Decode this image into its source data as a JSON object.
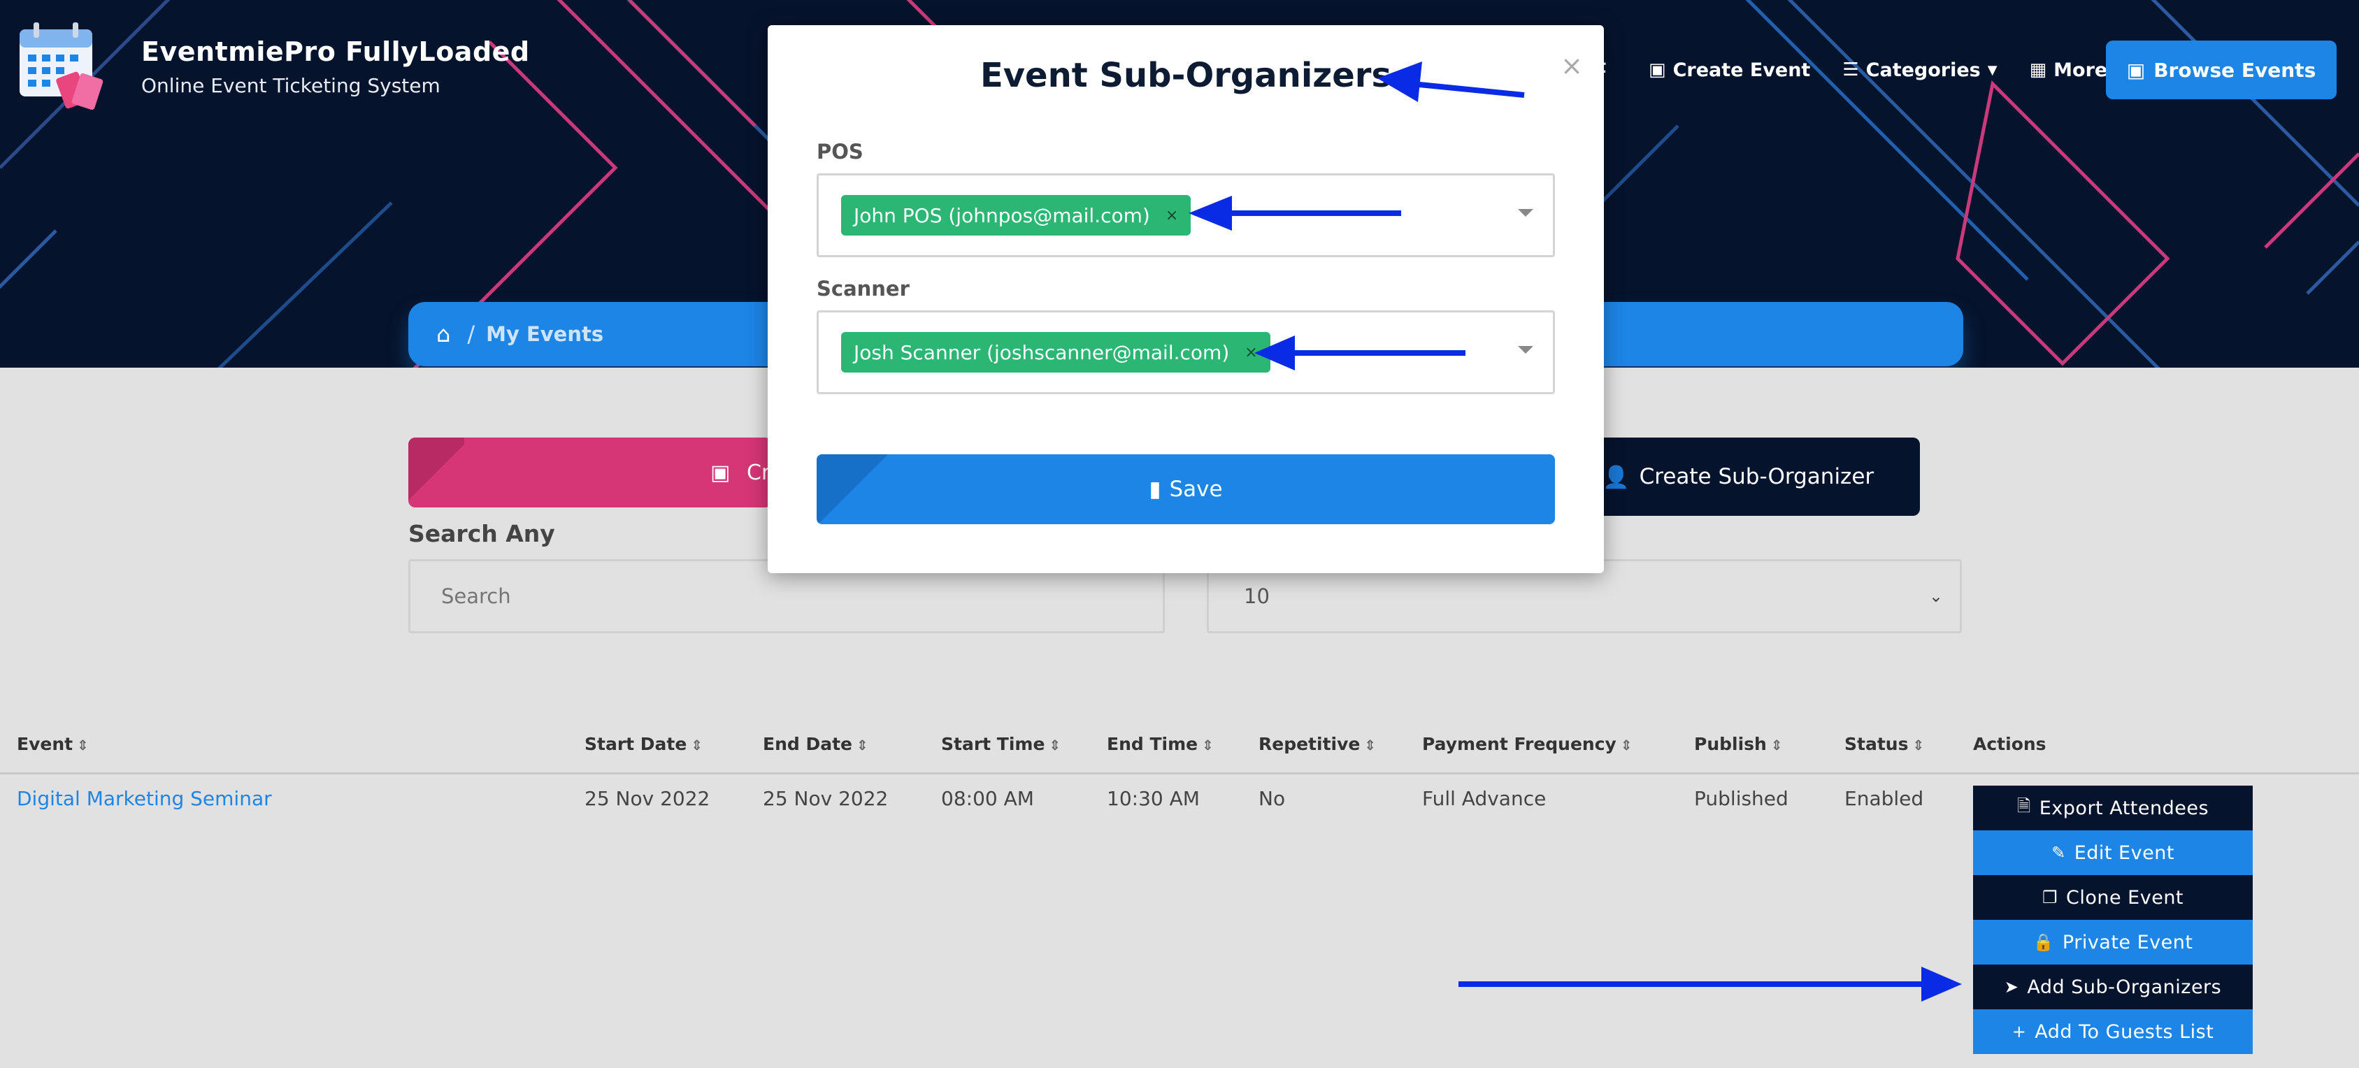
{
  "brand": {
    "title": "EventmiePro FullyLoaded",
    "subtitle": "Online Event Ticketing System"
  },
  "nav": {
    "partial_item": "et",
    "create_event": "Create Event",
    "categories": "Categories",
    "more": "More",
    "browse_events": "Browse Events"
  },
  "breadcrumb": {
    "current": "My Events"
  },
  "page": {
    "create_partial": "Cre",
    "create_sub_organizer": "Create Sub-Organizer",
    "search_label": "Search Any",
    "search_placeholder": "Search",
    "per_page_value": "10"
  },
  "table": {
    "headers": [
      "Event",
      "Start Date",
      "End Date",
      "Start Time",
      "End Time",
      "Repetitive",
      "Payment Frequency",
      "Publish",
      "Status",
      "Actions"
    ],
    "row": {
      "event": "Digital Marketing Seminar",
      "start_date": "25 Nov 2022",
      "end_date": "25 Nov 2022",
      "start_time": "08:00 AM",
      "end_time": "10:30 AM",
      "repetitive": "No",
      "payment_frequency": "Full Advance",
      "publish": "Published",
      "status": "Enabled"
    },
    "actions": [
      "Export Attendees",
      "Edit Event",
      "Clone Event",
      "Private Event",
      "Add Sub-Organizers",
      "Add To Guests List"
    ]
  },
  "modal": {
    "title": "Event Sub-Organizers",
    "close": "×",
    "pos_label": "POS",
    "pos_value": "John POS (johnpos@mail.com)",
    "scanner_label": "Scanner",
    "scanner_value": "Josh Scanner (joshscanner@mail.com)",
    "tag_remove": "×",
    "save": "Save"
  },
  "colors": {
    "navy": "#06132c",
    "blue": "#1d85e6",
    "pink": "#d63676",
    "green": "#2bb673",
    "annotation_arrow": "#0a2be6"
  }
}
